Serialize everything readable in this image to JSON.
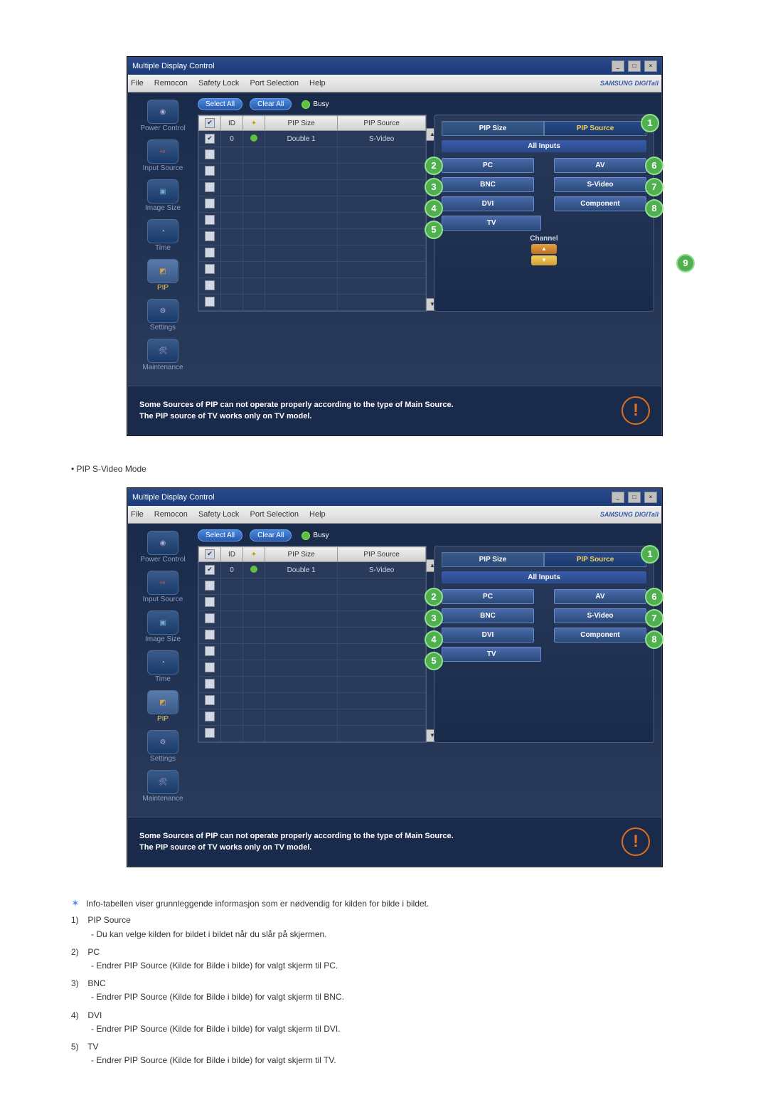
{
  "titlebar": {
    "title": "Multiple Display Control"
  },
  "menubar": {
    "items": [
      "File",
      "Remocon",
      "Safety Lock",
      "Port Selection",
      "Help"
    ],
    "brand": "SAMSUNG DIGITall"
  },
  "sidebar": {
    "items": [
      {
        "label": "Power Control"
      },
      {
        "label": "Input Source"
      },
      {
        "label": "Image Size"
      },
      {
        "label": "Time"
      },
      {
        "label": "PIP"
      },
      {
        "label": "Settings"
      },
      {
        "label": "Maintenance"
      }
    ],
    "active_index": 4
  },
  "toolbar": {
    "select_all": "Select All",
    "clear_all": "Clear All",
    "busy": "Busy"
  },
  "table": {
    "headers": {
      "chk": "",
      "id": "ID",
      "status": "",
      "size": "PIP Size",
      "source": "PIP Source"
    },
    "rows": [
      {
        "checked": true,
        "id": "0",
        "status": "on",
        "size": "Double 1",
        "source": "S-Video"
      }
    ],
    "empty_rows": 10
  },
  "panel": {
    "tabs": {
      "left": "PIP Size",
      "right": "PIP Source"
    },
    "all_inputs": "All Inputs",
    "channel_label": "Channel",
    "buttons": {
      "pc": "PC",
      "av": "AV",
      "bnc": "BNC",
      "svideo": "S-Video",
      "dvi": "DVI",
      "component": "Component",
      "tv": "TV"
    },
    "numbers": {
      "n1": "1",
      "n2": "2",
      "n3": "3",
      "n4": "4",
      "n5": "5",
      "n6": "6",
      "n7": "7",
      "n8": "8",
      "n9": "9"
    }
  },
  "footer": {
    "line1": "Some Sources of PIP can not operate properly according to the type of Main Source.",
    "line2": "The PIP source of TV works only on TV model."
  },
  "doc": {
    "section_heading": "PIP S-Video Mode",
    "info_intro": "Info-tabellen viser grunnleggende informasjon som er nødvendig for kilden for bilde i bildet.",
    "items": [
      {
        "n": "1)",
        "title": "PIP Source",
        "sub": "- Du kan velge kilden for bildet i bildet når du slår på skjermen."
      },
      {
        "n": "2)",
        "title": "PC",
        "sub": "- Endrer PIP Source (Kilde for Bilde i bilde) for valgt skjerm til PC."
      },
      {
        "n": "3)",
        "title": "BNC",
        "sub": "- Endrer PIP Source (Kilde for Bilde i bilde) for valgt skjerm til BNC."
      },
      {
        "n": "4)",
        "title": "DVI",
        "sub": "- Endrer PIP Source (Kilde for Bilde i bilde) for valgt skjerm til DVI."
      },
      {
        "n": "5)",
        "title": "TV",
        "sub": "- Endrer PIP Source (Kilde for Bilde i bilde) for valgt skjerm til TV."
      }
    ]
  }
}
